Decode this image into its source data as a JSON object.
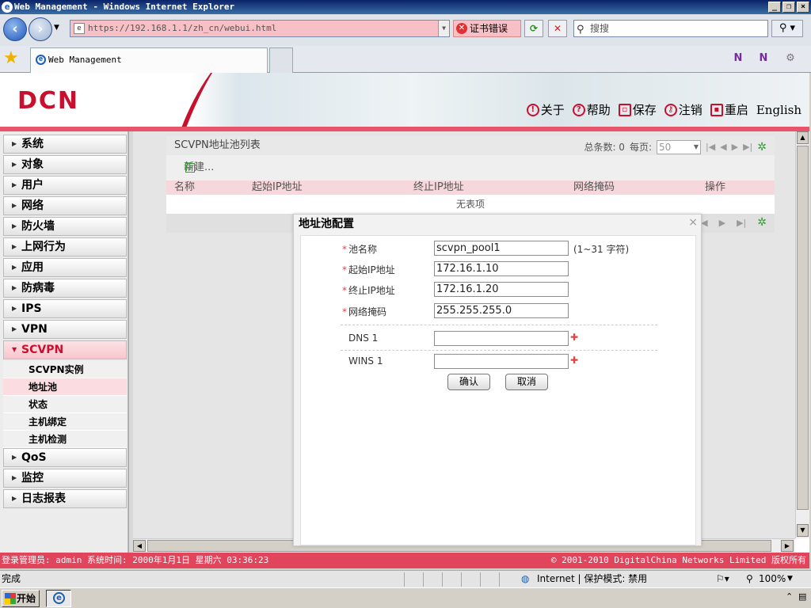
{
  "window": {
    "title": "Web Management - Windows Internet Explorer"
  },
  "browser": {
    "url": "https://192.168.1.1/zh_cn/webui.html",
    "cert_error": "证书错误",
    "search_placeholder": "搜搜",
    "tab_title": "Web Management"
  },
  "header": {
    "logo": "DCN",
    "links": [
      "关于",
      "帮助",
      "保存",
      "注销",
      "重启",
      "English"
    ]
  },
  "sidebar": {
    "items": [
      "系统",
      "对象",
      "用户",
      "网络",
      "防火墙",
      "上网行为",
      "应用",
      "防病毒",
      "IPS",
      "VPN",
      "SCVPN"
    ],
    "sub_items": [
      "SCVPN实例",
      "地址池",
      "状态",
      "主机绑定",
      "主机检测"
    ],
    "items_after": [
      "QoS",
      "监控",
      "日志报表"
    ],
    "active": "SCVPN",
    "selected_sub": "地址池"
  },
  "list": {
    "title": "SCVPN地址池列表",
    "total_label": "总条数: 0",
    "per_page_label": "每页:",
    "per_page_value": "50",
    "new_label": "新建...",
    "columns": [
      "名称",
      "起始IP地址",
      "终止IP地址",
      "网络掩码",
      "操作"
    ],
    "empty_text": "无表项"
  },
  "dialog": {
    "title": "地址池配置",
    "fields": [
      {
        "label": "池名称",
        "value": "scvpn_pool1",
        "hint": "(1~31 字符)",
        "required": true
      },
      {
        "label": "起始IP地址",
        "value": "172.16.1.10",
        "required": true
      },
      {
        "label": "终止IP地址",
        "value": "172.16.1.20",
        "required": true
      },
      {
        "label": "网络掩码",
        "value": "255.255.255.0",
        "required": true
      }
    ],
    "dns_label": "DNS 1",
    "dns_value": "",
    "wins_label": "WINS 1",
    "wins_value": "",
    "ok_label": "确认",
    "cancel_label": "取消"
  },
  "page_status": {
    "left": "登录管理员: admin 系统时间: 2000年1月1日 星期六 03:36:23",
    "right": "© 2001-2010 DigitalChina Networks Limited 版权所有"
  },
  "ie_status": {
    "text": "完成",
    "zone": "Internet | 保护模式: 禁用",
    "zoom": "100%"
  },
  "taskbar": {
    "start_label": "开始"
  }
}
